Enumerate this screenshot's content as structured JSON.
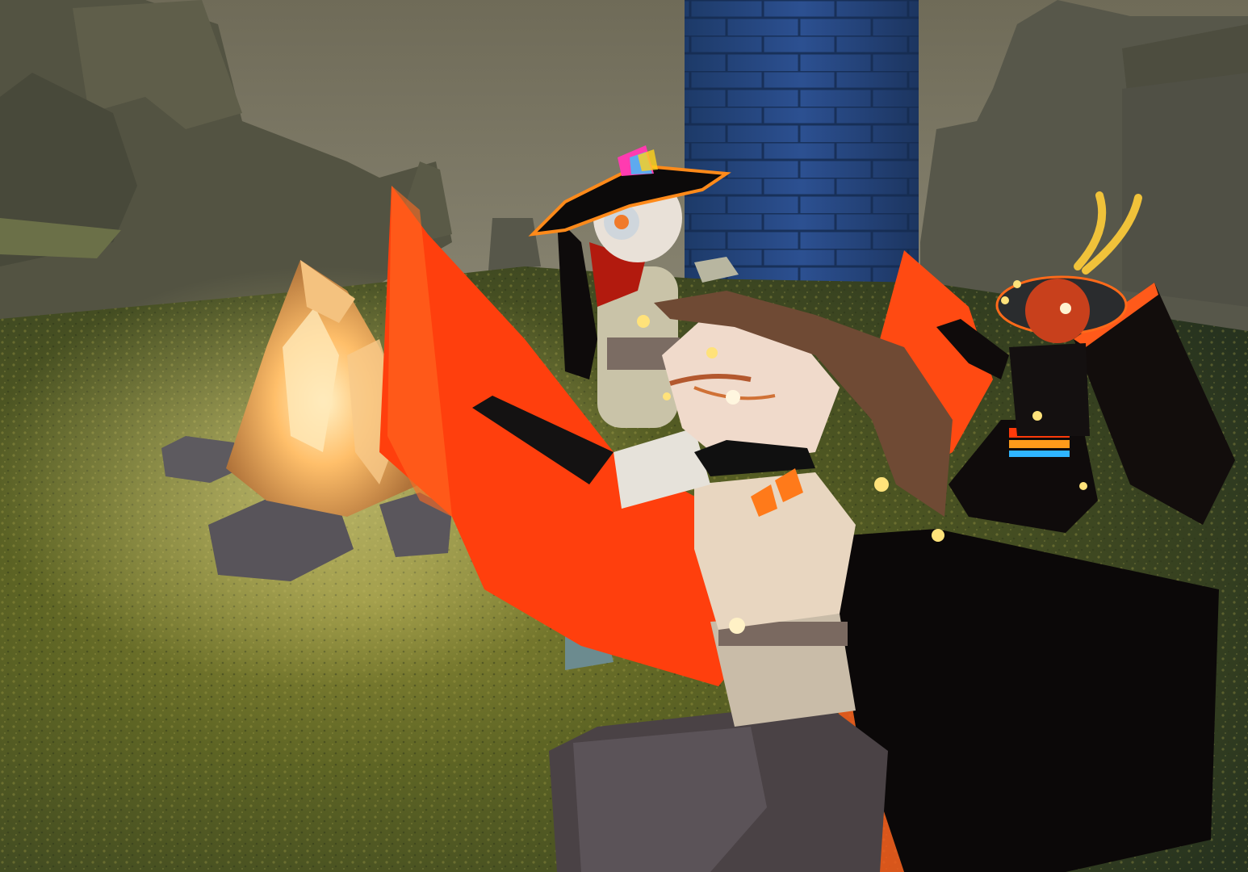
{
  "scene": {
    "palette": {
      "sky": "#6e6a57",
      "mountain": "#4f4f3f",
      "grass": "#4e5a22",
      "tower": "#26477f",
      "cape_red": "#ff3a0a",
      "cape_black": "#0b0808",
      "fire_glow": "#ffb05a",
      "skin_light": "#e7d8c6",
      "glow_dot": "#ffe27a"
    },
    "objects": [
      {
        "name": "campfire"
      },
      {
        "name": "stone-tower"
      },
      {
        "name": "character-front-red-cape"
      },
      {
        "name": "character-back-white-hair"
      },
      {
        "name": "character-right-antlers"
      }
    ]
  }
}
